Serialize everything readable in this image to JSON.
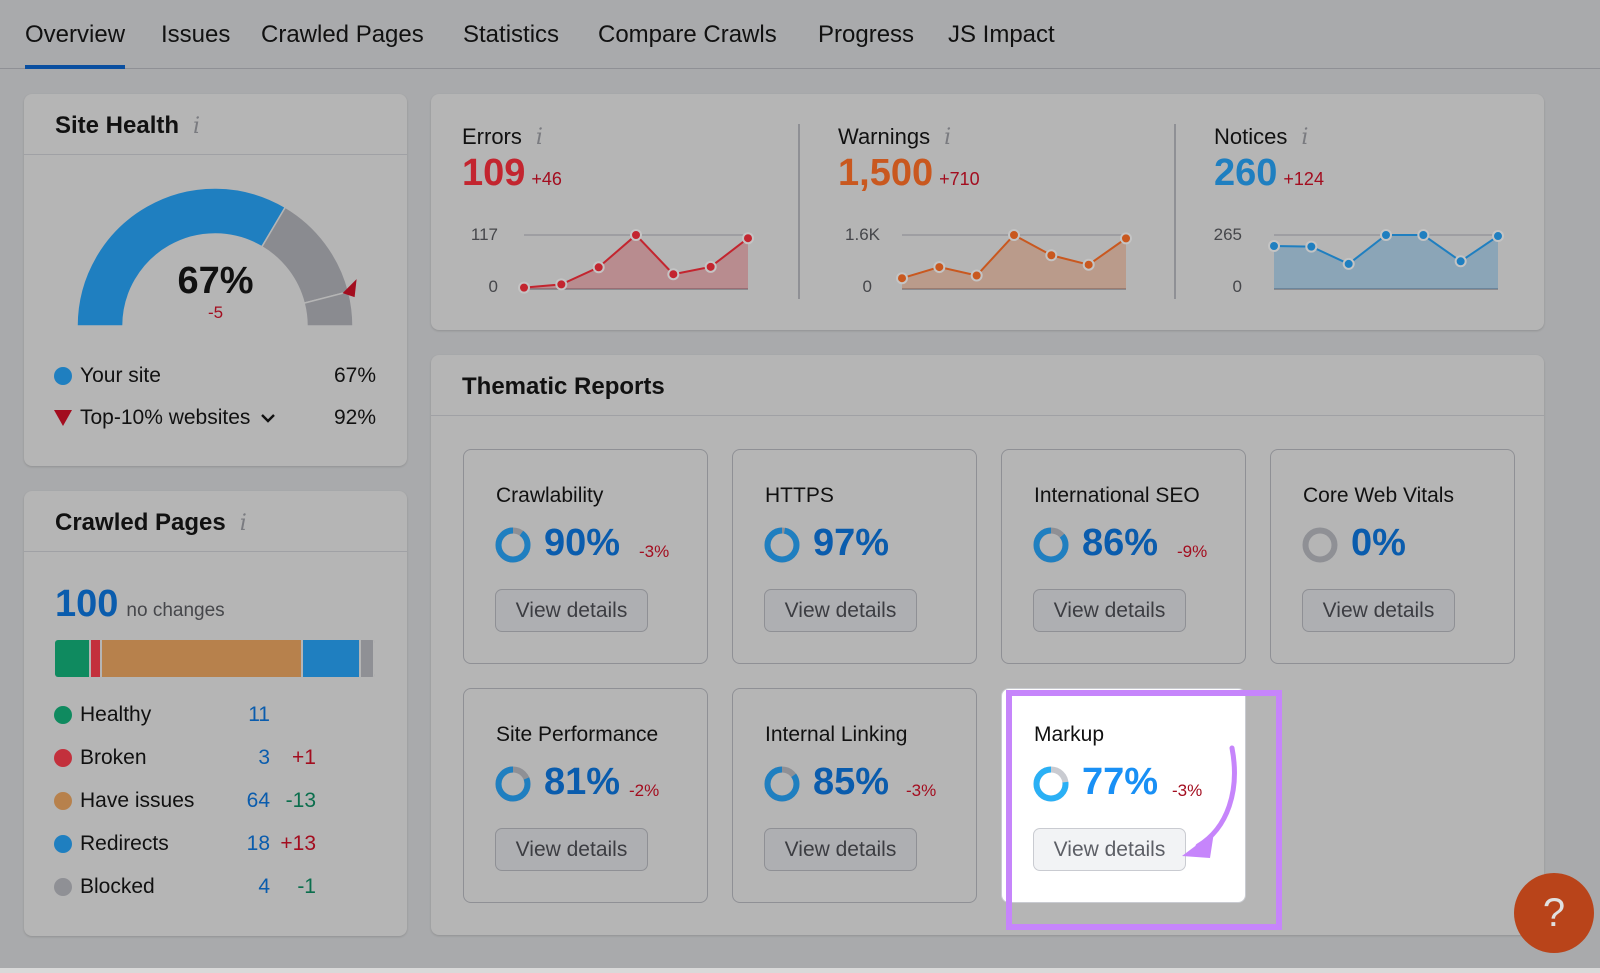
{
  "tabs": [
    {
      "label": "Overview",
      "active": true
    },
    {
      "label": "Issues"
    },
    {
      "label": "Crawled Pages"
    },
    {
      "label": "Statistics"
    },
    {
      "label": "Compare Crawls"
    },
    {
      "label": "Progress"
    },
    {
      "label": "JS Impact"
    }
  ],
  "site_health": {
    "title": "Site Health",
    "info": "i",
    "gauge_value": 67,
    "gauge_label": "67%",
    "gauge_delta": "-5",
    "top10_marker": 92,
    "legend": [
      {
        "label": "Your site",
        "value": "67%",
        "color": "#1f7fc0"
      },
      {
        "label": "Top-10% websites",
        "value": "92%",
        "color": "#a30d1f"
      }
    ]
  },
  "crawled_pages": {
    "title": "Crawled Pages",
    "info": "i",
    "total": "100",
    "total_note": "no changes",
    "items": [
      {
        "label": "Healthy",
        "count": "11",
        "delta": "",
        "delta_type": "",
        "color": "#0f8a5f",
        "value": 11
      },
      {
        "label": "Broken",
        "count": "3",
        "delta": "+1",
        "delta_type": "red",
        "color": "#c3303c",
        "value": 3
      },
      {
        "label": "Have issues",
        "count": "64",
        "delta": "-13",
        "delta_type": "green",
        "color": "#b7814c",
        "value": 64
      },
      {
        "label": "Redirects",
        "count": "18",
        "delta": "+13",
        "delta_type": "red",
        "color": "#1f7fc0",
        "value": 18
      },
      {
        "label": "Blocked",
        "count": "4",
        "delta": "-1",
        "delta_type": "green",
        "color": "#8f9095",
        "value": 4
      }
    ]
  },
  "metrics": [
    {
      "title": "Errors",
      "info": "i",
      "value": "109",
      "delta": "+46",
      "color": "#c3252f",
      "axis_max_label": "117",
      "axis_min_label": "0",
      "axis_max": 117,
      "series": [
        3,
        10,
        47,
        117,
        32,
        48,
        110
      ]
    },
    {
      "title": "Warnings",
      "info": "i",
      "value": "1,500",
      "delta": "+710",
      "color": "#c9581f",
      "axis_max_label": "1.6K",
      "axis_min_label": "0",
      "axis_max": 1600,
      "series": [
        320,
        650,
        400,
        1600,
        1000,
        720,
        1500
      ]
    },
    {
      "title": "Notices",
      "info": "i",
      "value": "260",
      "delta": "+124",
      "color": "#1f7fc0",
      "axis_max_label": "265",
      "axis_min_label": "0",
      "axis_max": 265,
      "series": [
        211,
        208,
        123,
        265,
        265,
        136,
        260
      ]
    }
  ],
  "thematic": {
    "title": "Thematic Reports",
    "button_label": "View details",
    "reports": [
      {
        "title": "Crawlability",
        "pct": 90,
        "pct_label": "90%",
        "delta": "-3%"
      },
      {
        "title": "HTTPS",
        "pct": 97,
        "pct_label": "97%",
        "delta": ""
      },
      {
        "title": "International SEO",
        "pct": 86,
        "pct_label": "86%",
        "delta": "-9%"
      },
      {
        "title": "Core Web Vitals",
        "pct": 0,
        "pct_label": "0%",
        "delta": ""
      },
      {
        "title": "Site Performance",
        "pct": 81,
        "pct_label": "81%",
        "delta": "-2%"
      },
      {
        "title": "Internal Linking",
        "pct": 85,
        "pct_label": "85%",
        "delta": "-3%"
      },
      {
        "title": "Markup",
        "pct": 77,
        "pct_label": "77%",
        "delta": "-3%",
        "highlighted": true
      }
    ]
  },
  "help_button": {
    "label": "?"
  },
  "colors": {
    "accent_blue": "#0a5cad",
    "highlight_purple": "#c685fb",
    "help_orange": "#b9441a",
    "delta_red": "#a30d1f",
    "delta_green": "#0b6e4d"
  }
}
